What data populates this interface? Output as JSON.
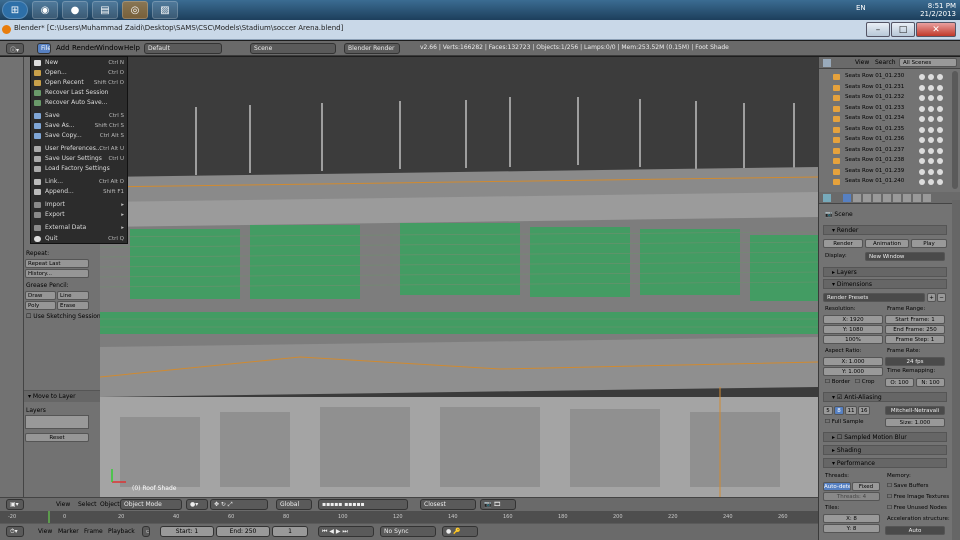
{
  "taskbar": {
    "icons": [
      "windows-start-icon",
      "chrome-icon",
      "firefox-icon",
      "explorer-icon",
      "blender-icon",
      "app-icon"
    ],
    "tray_time": "8:51 PM",
    "tray_date": "21/2/2013",
    "tray_lang": "EN"
  },
  "titlebar": {
    "title": "Blender* [C:\\Users\\Muhammad Zaidi\\Desktop\\SAMS\\CSC\\Models\\Stadium\\soccer Arena.blend]"
  },
  "infobar": {
    "menus": [
      "File",
      "Add",
      "Render",
      "Window",
      "Help"
    ],
    "layout": "Default",
    "scene": "Scene",
    "engine": "Blender Render",
    "stats": "v2.66 | Verts:166282 | Faces:132723 | Objects:1/256 | Lamps:0/0 | Mem:253.52M (0.15M) | Foot Shade"
  },
  "filemenu": {
    "items": [
      {
        "label": "New",
        "shortcut": "Ctrl N"
      },
      {
        "label": "Open...",
        "shortcut": "Ctrl O"
      },
      {
        "label": "Open Recent",
        "shortcut": "Shift Ctrl O"
      },
      {
        "label": "Recover Last Session",
        "shortcut": ""
      },
      {
        "label": "Recover Auto Save...",
        "shortcut": ""
      },
      {
        "label": "Save",
        "shortcut": "Ctrl S"
      },
      {
        "label": "Save As...",
        "shortcut": "Shift Ctrl S"
      },
      {
        "label": "Save Copy...",
        "shortcut": "Ctrl Alt S"
      },
      {
        "label": "User Preferences...",
        "shortcut": "Ctrl Alt U"
      },
      {
        "label": "Save User Settings",
        "shortcut": "Ctrl U"
      },
      {
        "label": "Load Factory Settings",
        "shortcut": ""
      },
      {
        "label": "Link...",
        "shortcut": "Ctrl Alt O"
      },
      {
        "label": "Append...",
        "shortcut": "Shift F1"
      },
      {
        "label": "Import",
        "shortcut": "▸"
      },
      {
        "label": "Export",
        "shortcut": "▸"
      },
      {
        "label": "External Data",
        "shortcut": "▸"
      },
      {
        "label": "Quit",
        "shortcut": "Ctrl Q"
      }
    ]
  },
  "toolshelf": {
    "repeat_label": "Repeat:",
    "repeat_last": "Repeat Last",
    "history": "History...",
    "grease_label": "Grease Pencil:",
    "draw": "Draw",
    "line": "Line",
    "poly": "Poly",
    "erase": "Erase",
    "sketch": "Use Sketching Sessions",
    "move_layer": "Move to Layer",
    "layers": "Layers",
    "reset": "Reset"
  },
  "viewport": {
    "label": "(0) Roof Shade",
    "sky_color": "#3b3b3b",
    "seat_color": "#3da060"
  },
  "outliner": {
    "view": "View",
    "search": "Search",
    "all_scenes": "All Scenes",
    "rows": [
      "Seats Row 01_01.230",
      "Seats Row 01_01.231",
      "Seats Row 01_01.232",
      "Seats Row 01_01.233",
      "Seats Row 01_01.234",
      "Seats Row 01_01.235",
      "Seats Row 01_01.236",
      "Seats Row 01_01.237",
      "Seats Row 01_01.238",
      "Seats Row 01_01.239",
      "Seats Row 01_01.240"
    ]
  },
  "properties": {
    "scene": "Scene",
    "render_hdr": "Render",
    "render_btn": "Render",
    "animation_btn": "Animation",
    "play_btn": "Play",
    "display_lbl": "Display:",
    "display_val": "New Window",
    "layers_hdr": "Layers",
    "dimensions_hdr": "Dimensions",
    "presets": "Render Presets",
    "resolution_lbl": "Resolution:",
    "res_x": "X: 1920",
    "res_y": "Y: 1080",
    "res_pct": "100%",
    "frame_range_lbl": "Frame Range:",
    "start_frame": "Start Frame: 1",
    "end_frame": "End Frame: 250",
    "frame_step": "Frame Step: 1",
    "aspect_lbl": "Aspect Ratio:",
    "aspect_x": "X: 1.000",
    "aspect_y": "Y: 1.000",
    "frame_rate_lbl": "Frame Rate:",
    "frame_rate": "24 fps",
    "time_remap": "Time Remapping:",
    "remap_old": "O: 100",
    "remap_new": "N: 100",
    "border": "Border",
    "crop": "Crop",
    "aa_hdr": "Anti-Aliasing",
    "aa_levels": [
      "5",
      "8",
      "11",
      "16"
    ],
    "aa_filter": "Mitchell-Netravali",
    "full_sample": "Full Sample",
    "aa_size": "Size: 1.000",
    "motion_blur_hdr": "Sampled Motion Blur",
    "shading_hdr": "Shading",
    "performance_hdr": "Performance",
    "threads_lbl": "Threads:",
    "auto_detect": "Auto-detect",
    "fixed": "Fixed",
    "threads_val": "Threads: 4",
    "memory_lbl": "Memory:",
    "save_buffers": "Save Buffers",
    "free_image": "Free Image Textures",
    "free_unused": "Free Unused Nodes",
    "tiles_lbl": "Tiles:",
    "tile_x": "X: 8",
    "tile_y": "Y: 8",
    "accel_lbl": "Acceleration structure:",
    "accel_val": "Auto"
  },
  "vp_header": {
    "view": "View",
    "select": "Select",
    "object": "Object",
    "mode": "Object Mode",
    "pivot": "Global",
    "snap": "Closest"
  },
  "timeline": {
    "menus": [
      "View",
      "Marker",
      "Frame",
      "Playback"
    ],
    "start": "Start: 1",
    "end": "End: 250",
    "current": "1",
    "sync": "No Sync",
    "ticks": [
      "-20",
      "0",
      "20",
      "40",
      "60",
      "80",
      "100",
      "120",
      "140",
      "160",
      "180",
      "200",
      "220",
      "240",
      "260"
    ]
  }
}
